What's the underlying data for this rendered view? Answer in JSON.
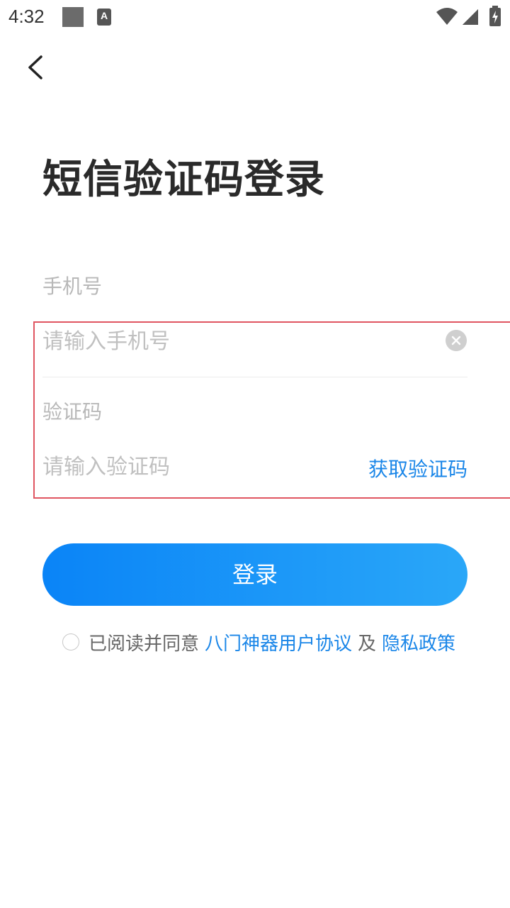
{
  "status_bar": {
    "time": "4:32",
    "notification_icon": "A"
  },
  "icons": {
    "back": "chevron-left-icon",
    "clear": "clear-circle-icon",
    "wifi": "wifi-icon",
    "signal": "cell-signal-icon",
    "battery": "battery-charging-icon"
  },
  "title": "短信验证码登录",
  "phone": {
    "label": "手机号",
    "placeholder": "请输入手机号",
    "value": ""
  },
  "code": {
    "label": "验证码",
    "placeholder": "请输入验证码",
    "value": "",
    "get_code_label": "获取验证码"
  },
  "login_button": "登录",
  "agreement": {
    "checked": false,
    "prefix": "已阅读并同意",
    "user_agreement": "八门神器用户协议",
    "conjunction": "及",
    "privacy_policy": "隐私政策"
  },
  "colors": {
    "accent": "#1a86e8",
    "button_gradient_start": "#0a84f7",
    "button_gradient_end": "#2aa7f8",
    "highlight_border": "#e05561"
  }
}
